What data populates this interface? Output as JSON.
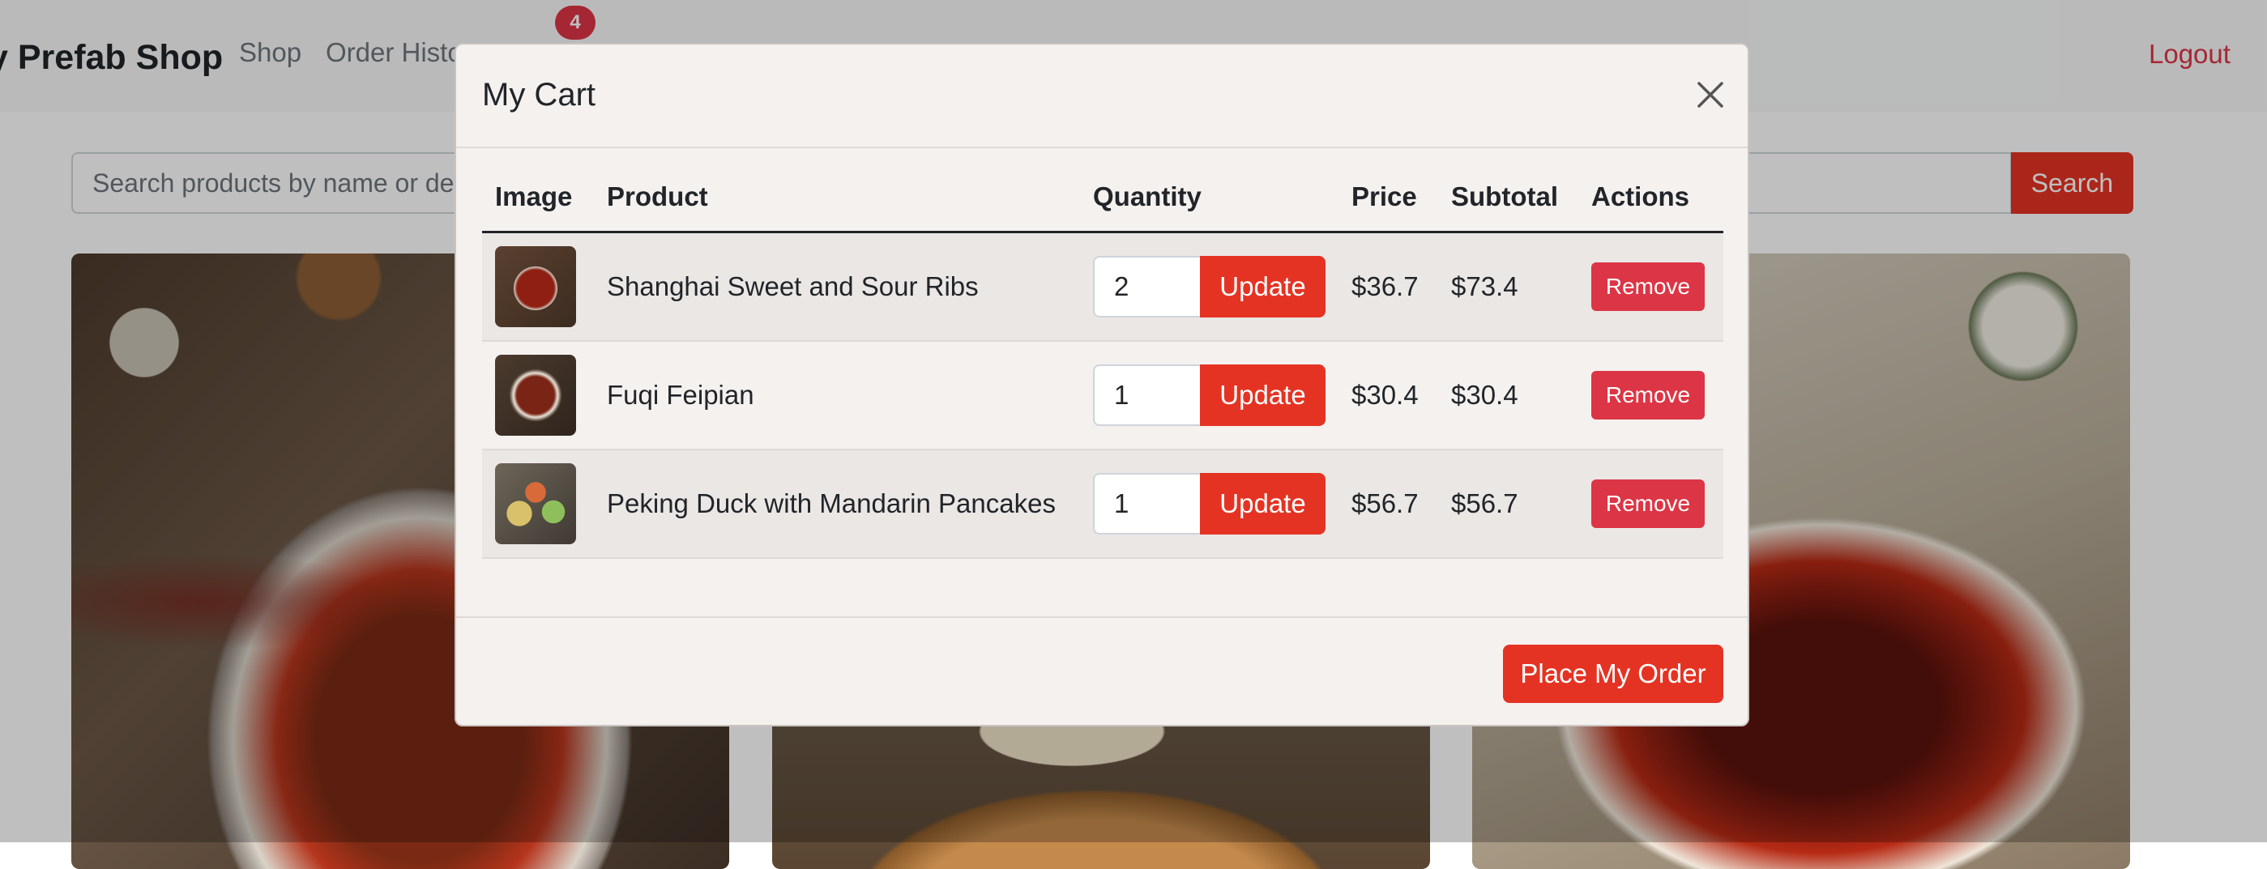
{
  "navbar": {
    "brand": "y Prefab Shop",
    "links": [
      "Shop",
      "Order Histo"
    ],
    "cart_badge": "4",
    "logout": "Logout"
  },
  "search": {
    "placeholder": "Search products by name or de",
    "button": "Search"
  },
  "modal": {
    "title": "My Cart",
    "columns": [
      "Image",
      "Product",
      "Quantity",
      "Price",
      "Subtotal",
      "Actions"
    ],
    "items": [
      {
        "product": "Shanghai Sweet and Sour Ribs",
        "quantity": "2",
        "price": "$36.7",
        "subtotal": "$73.4",
        "update": "Update",
        "remove": "Remove"
      },
      {
        "product": "Fuqi Feipian",
        "quantity": "1",
        "price": "$30.4",
        "subtotal": "$30.4",
        "update": "Update",
        "remove": "Remove"
      },
      {
        "product": "Peking Duck with Mandarin Pancakes",
        "quantity": "1",
        "price": "$56.7",
        "subtotal": "$56.7",
        "update": "Update",
        "remove": "Remove"
      }
    ],
    "place_order": "Place My Order"
  },
  "colors": {
    "accent": "#e53323",
    "danger": "#dc3545",
    "modal_bg": "#f5f1ef"
  },
  "icons": [
    "close-icon"
  ]
}
